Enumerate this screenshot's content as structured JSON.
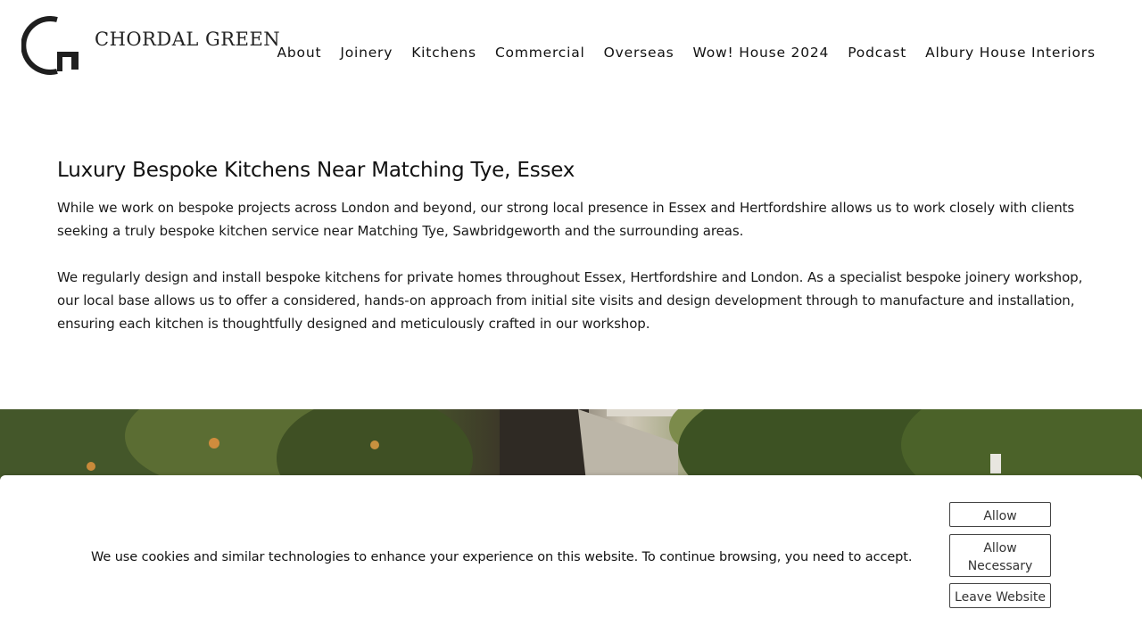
{
  "brand": {
    "name": "CHORDAL GREEN",
    "logo_icon": "chordal-green-g-mark",
    "color": "#1f1f1f"
  },
  "nav": {
    "items": [
      {
        "label": "About"
      },
      {
        "label": "Joinery"
      },
      {
        "label": "Kitchens"
      },
      {
        "label": "Commercial"
      },
      {
        "label": "Overseas"
      },
      {
        "label": "Wow! House 2024"
      },
      {
        "label": "Podcast"
      },
      {
        "label": "Albury House Interiors"
      }
    ]
  },
  "main": {
    "title": "Luxury Bespoke Kitchens Near Matching Tye, Essex",
    "paragraphs": [
      "While we work on bespoke projects across London and beyond, our strong local presence in Essex and Hertfordshire allows us to work closely with clients seeking a truly bespoke kitchen service near Matching Tye, Sawbridgeworth and the surrounding areas.",
      "We regularly design and install bespoke kitchens for private homes throughout Essex, Hertfordshire and London. As a specialist bespoke joinery workshop, our local base allows us to offer a considered, hands-on approach from initial site visits and design development through to manufacture and installation, ensuring each kitchen is thoughtfully designed and meticulously crafted in our workshop."
    ]
  },
  "hero_image": {
    "subject": "workshop-barn-among-trees"
  },
  "cookie_banner": {
    "message": "We use cookies and similar technologies to enhance your experience on this website. To continue browsing, you need to accept.",
    "allow_label": "Allow",
    "allow_necessary_label": "Allow Necessary",
    "leave_label": "Leave Website"
  }
}
